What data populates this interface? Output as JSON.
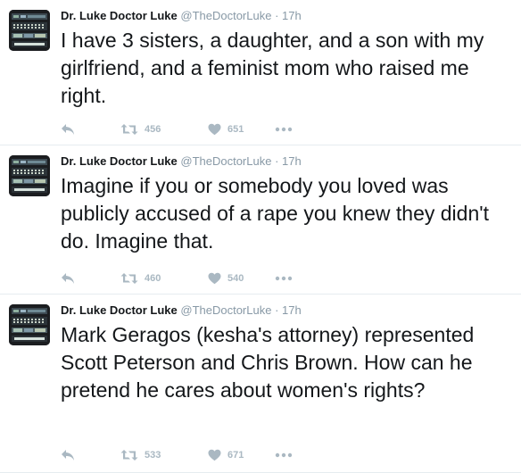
{
  "colors": {
    "text": "#14171a",
    "meta": "#8899a6",
    "action": "#aab8c2",
    "divider": "#e6ecf0"
  },
  "icons": {
    "reply": "reply-icon",
    "retweet": "retweet-icon",
    "like": "heart-icon",
    "more": "more-dots-icon"
  },
  "tweets": [
    {
      "name": "Dr. Luke Doctor Luke",
      "handle": "@TheDoctorLuke",
      "separator": "·",
      "time": "17h",
      "text": "I have 3 sisters, a daughter, and a son with my girlfriend, and a feminist mom who raised me right.",
      "retweets": "456",
      "likes": "651"
    },
    {
      "name": "Dr. Luke Doctor Luke",
      "handle": "@TheDoctorLuke",
      "separator": "·",
      "time": "17h",
      "text": "Imagine if you or somebody you loved was publicly accused of a rape you knew they didn't do.  Imagine that.",
      "retweets": "460",
      "likes": "540"
    },
    {
      "name": "Dr. Luke Doctor Luke",
      "handle": "@TheDoctorLuke",
      "separator": "·",
      "time": "17h",
      "text": "Mark Geragos (kesha's attorney) represented Scott Peterson and Chris Brown.  How can he pretend he cares about women's rights?",
      "retweets": "533",
      "likes": "671"
    }
  ]
}
